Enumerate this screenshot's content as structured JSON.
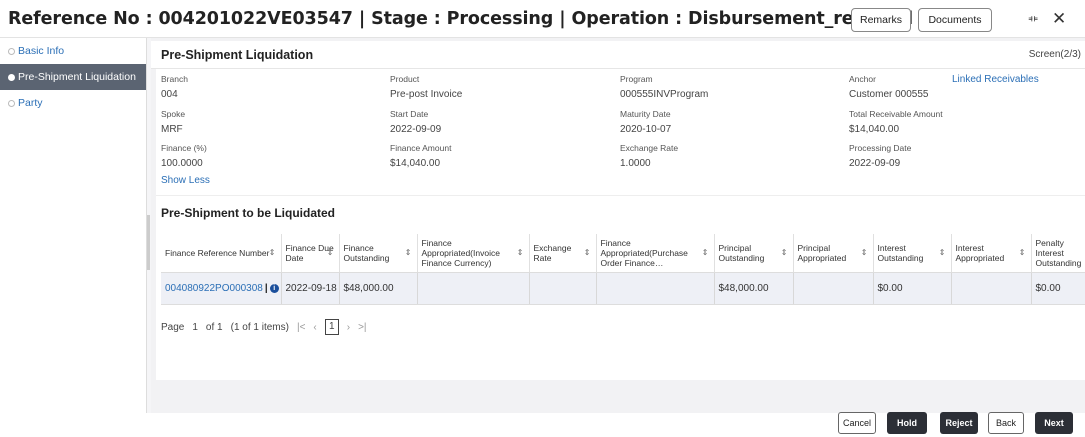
{
  "header": {
    "title": "Reference No : 004201022VE03547 | Stage : Processing | Operation : Disbursement_reversal",
    "remarks_label": "Remarks",
    "documents_label": "Documents"
  },
  "sidebar": {
    "items": [
      {
        "label": "Basic Info"
      },
      {
        "label": "Pre-Shipment Liquidation"
      },
      {
        "label": "Party"
      }
    ]
  },
  "section": {
    "title": "Pre-Shipment Liquidation",
    "screen": "Screen(2/3)"
  },
  "info": {
    "branch_label": "Branch",
    "branch_value": "004",
    "product_label": "Product",
    "product_value": "Pre-post Invoice",
    "program_label": "Program",
    "program_value": "000555INVProgram",
    "anchor_label": "Anchor",
    "anchor_value": "Customer 000555",
    "linked_receivables": "Linked Receivables",
    "spoke_label": "Spoke",
    "spoke_value": "MRF",
    "start_date_label": "Start Date",
    "start_date_value": "2022-09-09",
    "maturity_date_label": "Maturity Date",
    "maturity_date_value": "2020-10-07",
    "total_recv_label": "Total Receivable Amount",
    "total_recv_value": "$14,040.00",
    "finance_pct_label": "Finance (%)",
    "finance_pct_value": "100.0000",
    "finance_amt_label": "Finance Amount",
    "finance_amt_value": "$14,040.00",
    "exchange_rate_label": "Exchange Rate",
    "exchange_rate_value": "1.0000",
    "processing_date_label": "Processing Date",
    "processing_date_value": "2022-09-09",
    "show_less": "Show Less"
  },
  "grid": {
    "title": "Pre-Shipment to be Liquidated",
    "columns": [
      "Finance Reference Number",
      "Finance Due Date",
      "Finance Outstanding",
      "Finance Appropriated(Invoice Finance Currency)",
      "Exchange Rate",
      "Finance Appropriated(Purchase Order Finance…",
      "Principal Outstanding",
      "Principal Appropriated",
      "Interest Outstanding",
      "Interest Appropriated",
      "Penalty Interest Outstanding"
    ],
    "row": {
      "ref": "004080922PO000308",
      "due_date": "2022-09-18",
      "finance_outstanding": "$48,000.00",
      "appropriated_invoice": "",
      "exchange_rate": "",
      "appropriated_po": "",
      "principal_outstanding": "$48,000.00",
      "principal_appropriated": "",
      "interest_outstanding": "$0.00",
      "interest_appropriated": "",
      "penalty_outstanding": "$0.00"
    }
  },
  "pager": {
    "page_label": "Page",
    "page_num": "1",
    "of_label": "of 1",
    "items_label": "(1 of 1 items)",
    "current": "1"
  },
  "footer": {
    "cancel": "Cancel",
    "hold": "Hold",
    "reject": "Reject",
    "back": "Back",
    "next": "Next"
  }
}
